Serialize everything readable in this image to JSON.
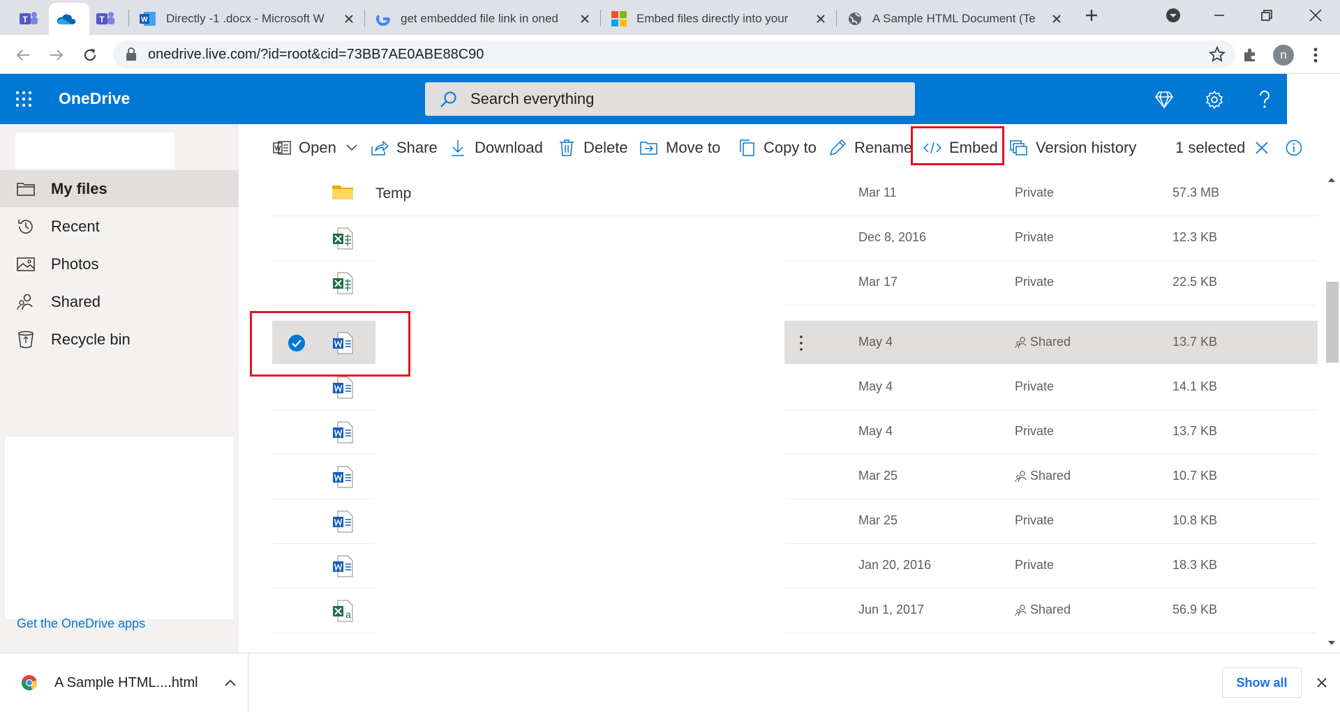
{
  "browser": {
    "tabs": [
      {
        "title": "",
        "icon": "teams-icon"
      },
      {
        "title": "",
        "icon": "onedrive-icon",
        "active": true
      },
      {
        "title": "",
        "icon": "teams-icon"
      },
      {
        "title": "Directly -1 .docx - Microsoft W",
        "icon": "word-icon"
      },
      {
        "title": "get embedded file link in oned",
        "icon": "google-icon"
      },
      {
        "title": "Embed files directly into your",
        "icon": "microsoft-icon"
      },
      {
        "title": "A Sample HTML Document (Te",
        "icon": "globe-icon"
      }
    ],
    "url": "onedrive.live.com/?id=root&cid=73BB7AE0ABE88C90",
    "profile_initial": "n"
  },
  "header": {
    "brand": "OneDrive",
    "search_placeholder": "Search everything"
  },
  "sidebar": {
    "items": [
      {
        "label": "My files",
        "icon": "folder-icon",
        "selected": true
      },
      {
        "label": "Recent",
        "icon": "history-icon"
      },
      {
        "label": "Photos",
        "icon": "photo-icon"
      },
      {
        "label": "Shared",
        "icon": "people-icon"
      },
      {
        "label": "Recycle bin",
        "icon": "recycle-bin-icon"
      }
    ],
    "get_apps": "Get the OneDrive apps"
  },
  "commandbar": {
    "open": "Open",
    "share": "Share",
    "download": "Download",
    "delete": "Delete",
    "move_to": "Move to",
    "copy_to": "Copy to",
    "rename": "Rename",
    "embed": "Embed",
    "version_history": "Version history",
    "selected_count": "1 selected"
  },
  "files": [
    {
      "type": "folder",
      "name": "Temp",
      "modified": "Mar 11",
      "sharing": "Private",
      "size": "57.3 MB"
    },
    {
      "type": "excel",
      "name": "",
      "modified": "Dec 8, 2016",
      "sharing": "Private",
      "size": "12.3 KB"
    },
    {
      "type": "excel",
      "name": "",
      "modified": "Mar 17",
      "sharing": "Private",
      "size": "22.5 KB"
    },
    {
      "type": "word",
      "name": "",
      "modified": "May 4",
      "sharing": "Shared",
      "size": "13.7 KB",
      "selected": true
    },
    {
      "type": "word",
      "name": "",
      "modified": "May 4",
      "sharing": "Private",
      "size": "14.1 KB"
    },
    {
      "type": "word",
      "name": "",
      "modified": "May 4",
      "sharing": "Private",
      "size": "13.7 KB"
    },
    {
      "type": "word",
      "name": "",
      "modified": "Mar 25",
      "sharing": "Shared",
      "size": "10.7 KB"
    },
    {
      "type": "word",
      "name": "",
      "modified": "Mar 25",
      "sharing": "Private",
      "size": "10.8 KB"
    },
    {
      "type": "word",
      "name": "",
      "modified": "Jan 20, 2016",
      "sharing": "Private",
      "size": "18.3 KB"
    },
    {
      "type": "excel-a",
      "name": "",
      "modified": "Jun 1, 2017",
      "sharing": "Shared",
      "size": "56.9 KB"
    }
  ],
  "download_shelf": {
    "file": "A Sample HTML....html",
    "show_all": "Show all"
  },
  "colors": {
    "brand_blue": "#0078d4",
    "highlight_red": "#e81123",
    "excel_green": "#1d6f42",
    "word_blue": "#185abd"
  }
}
